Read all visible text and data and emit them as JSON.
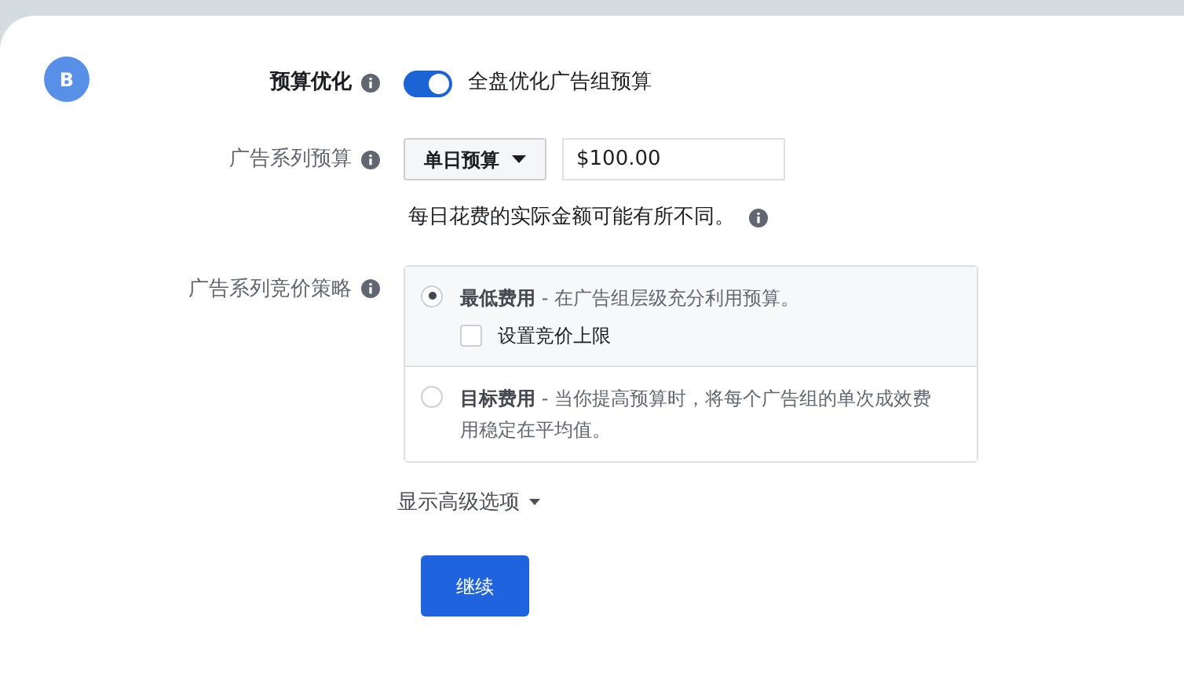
{
  "step_badge": "B",
  "budget_optimization": {
    "label": "预算优化",
    "on": true,
    "text": "全盘优化广告组预算"
  },
  "campaign_budget": {
    "label": "广告系列预算",
    "budget_type": "单日预算",
    "amount": "$100.00",
    "note": "每日花费的实际金额可能有所不同。"
  },
  "bid_strategy": {
    "label": "广告系列竞价策略",
    "options": [
      {
        "title": "最低费用",
        "description": "- 在广告组层级充分利用预算。",
        "selected": true,
        "checkbox": {
          "label": "设置竞价上限",
          "checked": false
        }
      },
      {
        "title": "目标费用",
        "description": "- 当你提高预算时，将每个广告组的单次成效费用稳定在平均值。",
        "selected": false
      }
    ]
  },
  "advanced_link": "显示高级选项",
  "continue_button": "继续"
}
